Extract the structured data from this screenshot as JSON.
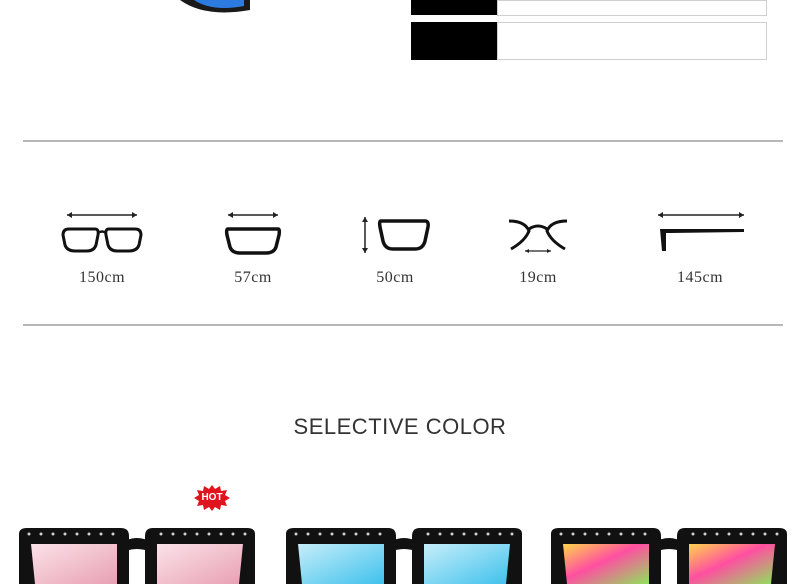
{
  "measurements": [
    {
      "label": "150cm",
      "icon": "lens-width-icon"
    },
    {
      "label": "57cm",
      "icon": "lens-height-icon"
    },
    {
      "label": "50cm",
      "icon": "frame-height-icon"
    },
    {
      "label": "19cm",
      "icon": "bridge-width-icon"
    },
    {
      "label": "145cm",
      "icon": "temple-length-icon"
    }
  ],
  "section_title": "SELECTIVE COLOR",
  "badge": {
    "text": "HOT",
    "color": "#e0141e"
  },
  "products": [
    {
      "lens_colors": [
        "#f7c5cf",
        "#e9a3b6"
      ],
      "frame_color": "#111111"
    },
    {
      "lens_colors": [
        "#a9e4f6",
        "#4cc6ee"
      ],
      "frame_color": "#111111"
    },
    {
      "lens_colors": [
        "#ffd54a",
        "#ff4fa1",
        "#8fe35b"
      ],
      "frame_color": "#111111"
    }
  ]
}
